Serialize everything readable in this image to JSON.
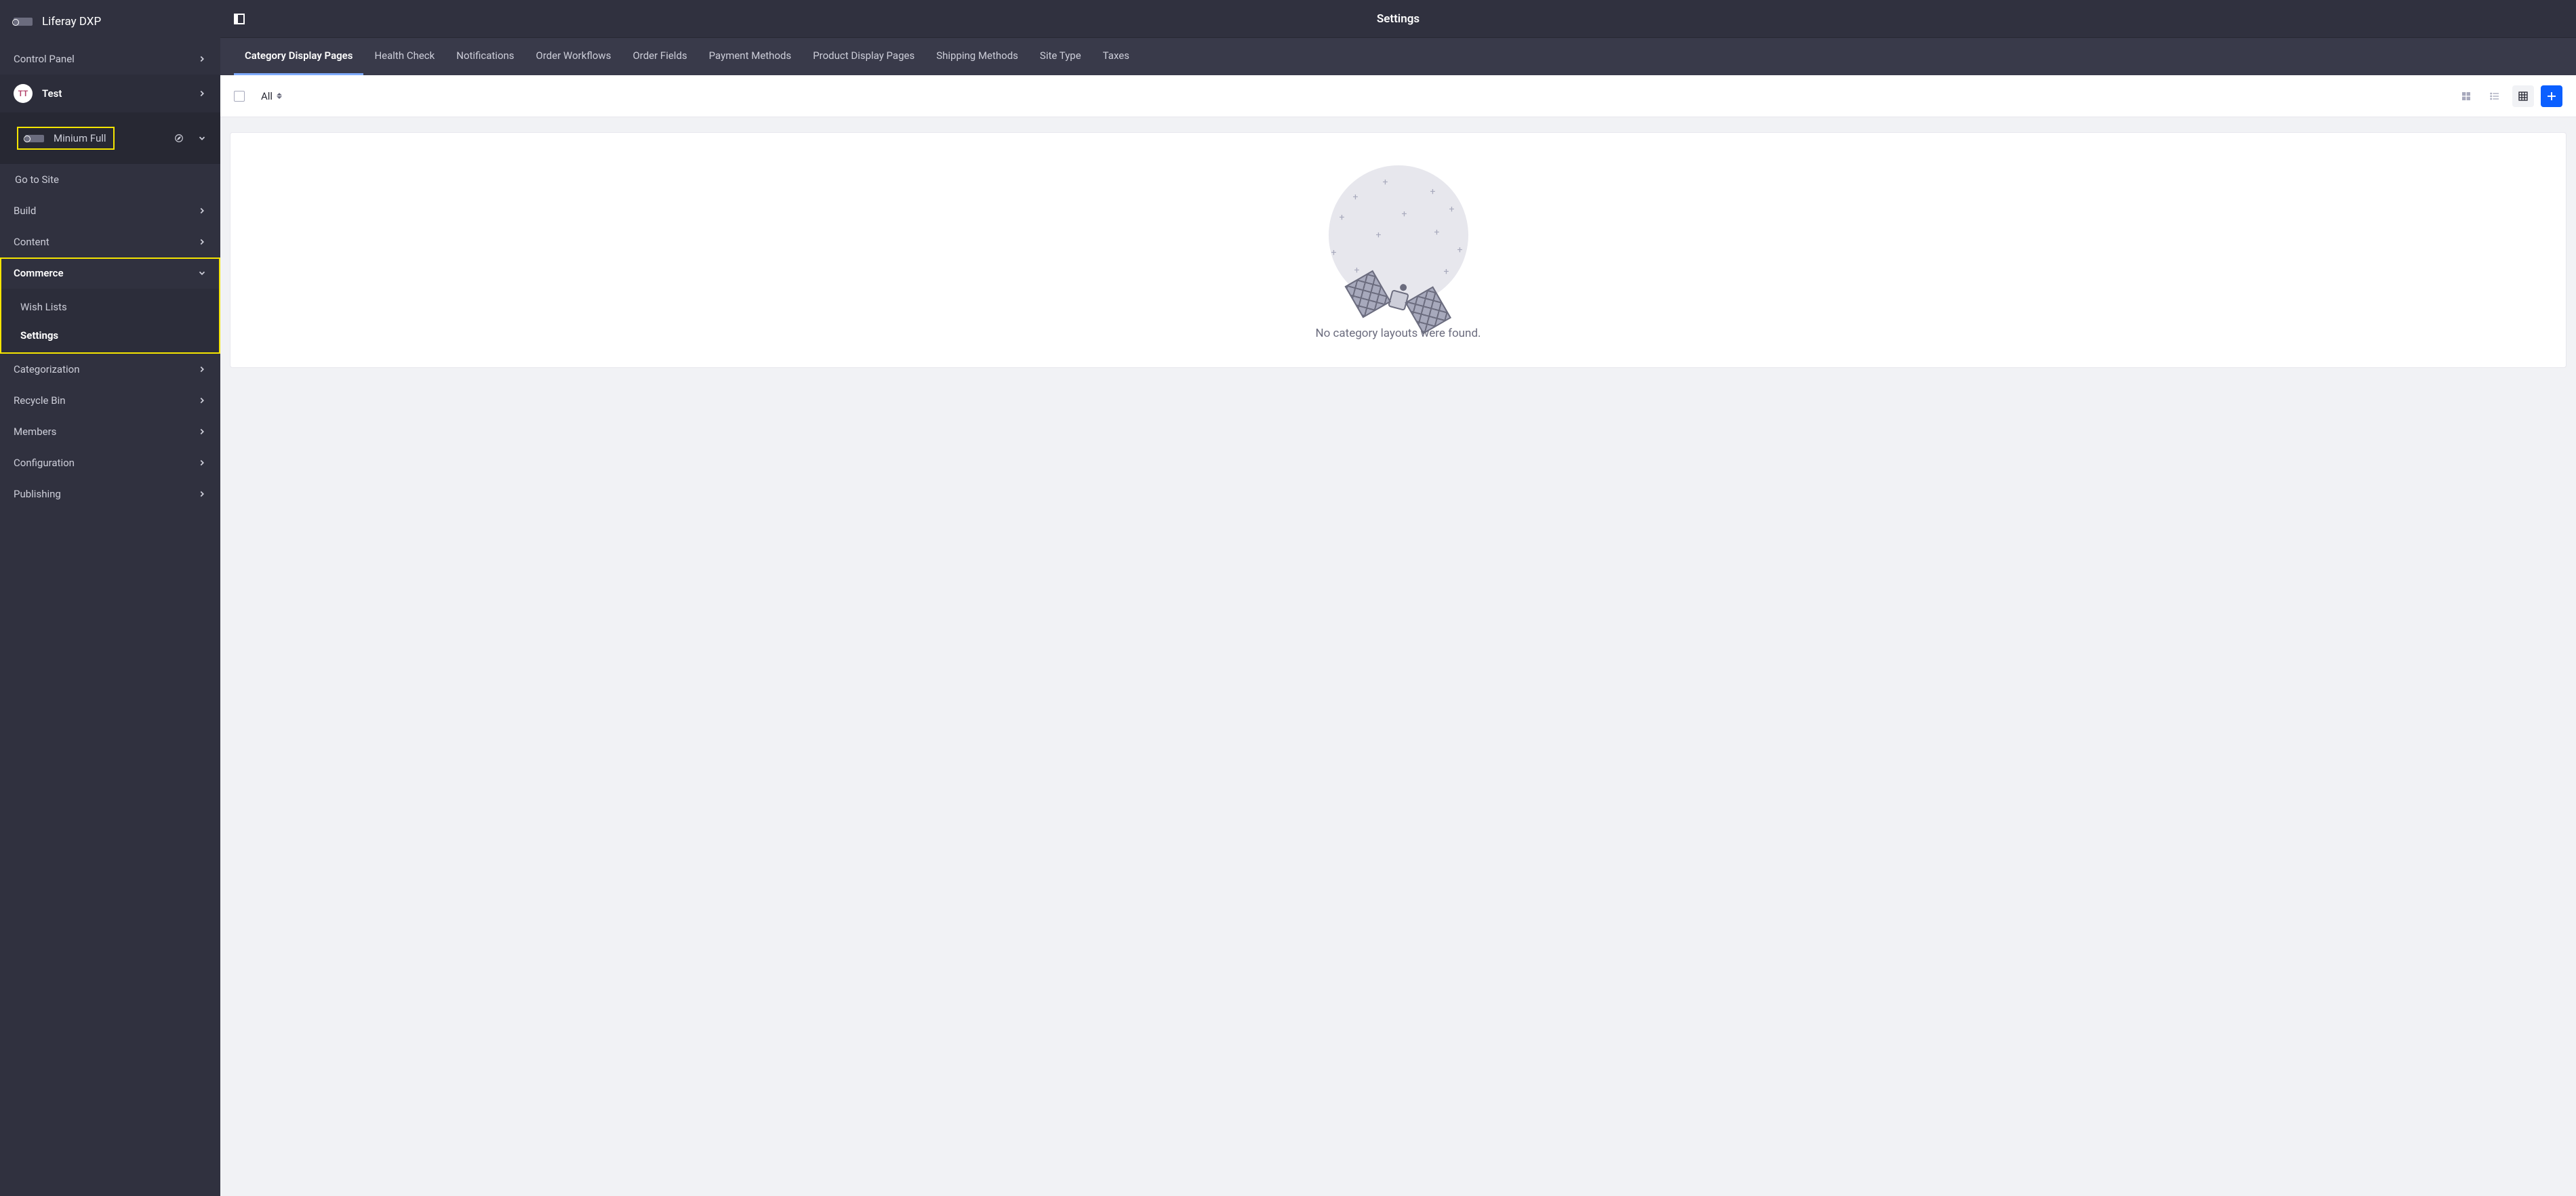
{
  "brand": {
    "title": "Liferay DXP"
  },
  "sidebar": {
    "control_panel": "Control Panel",
    "user": {
      "initials": "TT",
      "name": "Test"
    },
    "site": {
      "name": "Minium Full"
    },
    "go_to_site": "Go to Site",
    "build": "Build",
    "content": "Content",
    "commerce": {
      "label": "Commerce",
      "items": [
        "Wish Lists",
        "Settings"
      ],
      "active_index": 1
    },
    "categorization": "Categorization",
    "recycle_bin": "Recycle Bin",
    "members": "Members",
    "configuration": "Configuration",
    "publishing": "Publishing"
  },
  "header": {
    "title": "Settings"
  },
  "tabs": {
    "items": [
      "Category Display Pages",
      "Health Check",
      "Notifications",
      "Order Workflows",
      "Order Fields",
      "Payment Methods",
      "Product Display Pages",
      "Shipping Methods",
      "Site Type",
      "Taxes"
    ],
    "active_index": 0
  },
  "toolbar": {
    "filter_label": "All"
  },
  "empty": {
    "message": "No category layouts were found."
  }
}
